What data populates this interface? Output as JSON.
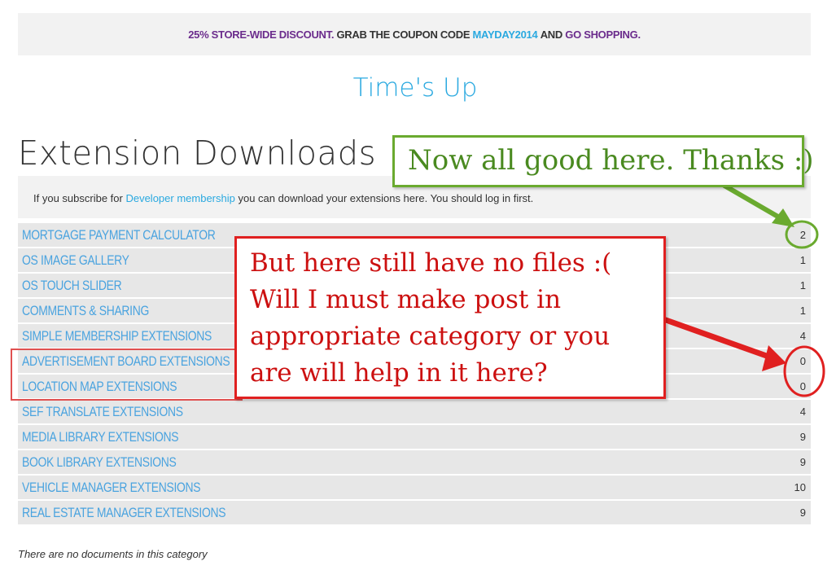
{
  "promo": {
    "part1": "25% STORE-WIDE DISCOUNT.",
    "part2": "GRAB THE COUPON CODE",
    "coupon": "MAYDAY2014",
    "part3": "AND",
    "link": "GO SHOPPING."
  },
  "times_up": "Time's Up",
  "page_title": "Extension Downloads",
  "info": {
    "before": "If you subscribe for",
    "link": "Developer membership",
    "after": "you can download your extensions here. You should log in first."
  },
  "extensions": [
    {
      "name": "MORTGAGE PAYMENT CALCULATOR",
      "count": "2"
    },
    {
      "name": "OS IMAGE GALLERY",
      "count": "1"
    },
    {
      "name": "OS TOUCH SLIDER",
      "count": "1"
    },
    {
      "name": "COMMENTS & SHARING",
      "count": "1"
    },
    {
      "name": "SIMPLE MEMBERSHIP EXTENSIONS",
      "count": "4"
    },
    {
      "name": "ADVERTISEMENT BOARD EXTENSIONS",
      "count": "0"
    },
    {
      "name": "LOCATION MAP EXTENSIONS",
      "count": "0"
    },
    {
      "name": "SEF TRANSLATE EXTENSIONS",
      "count": "4"
    },
    {
      "name": "MEDIA LIBRARY EXTENSIONS",
      "count": "9"
    },
    {
      "name": "BOOK LIBRARY EXTENSIONS",
      "count": "9"
    },
    {
      "name": "VEHICLE MANAGER EXTENSIONS",
      "count": "10"
    },
    {
      "name": "REAL ESTATE MANAGER EXTENSIONS",
      "count": "9"
    }
  ],
  "no_docs": "There are no documents in this category",
  "annotations": {
    "green_note": "Now all good here. Thanks :)",
    "red_note_lines": [
      "But here still have no files :(",
      "Will I must make post in",
      "appropriate category or you",
      "are will help in it here?"
    ],
    "green_color": "#6aaa2f",
    "red_color": "#e02020"
  }
}
